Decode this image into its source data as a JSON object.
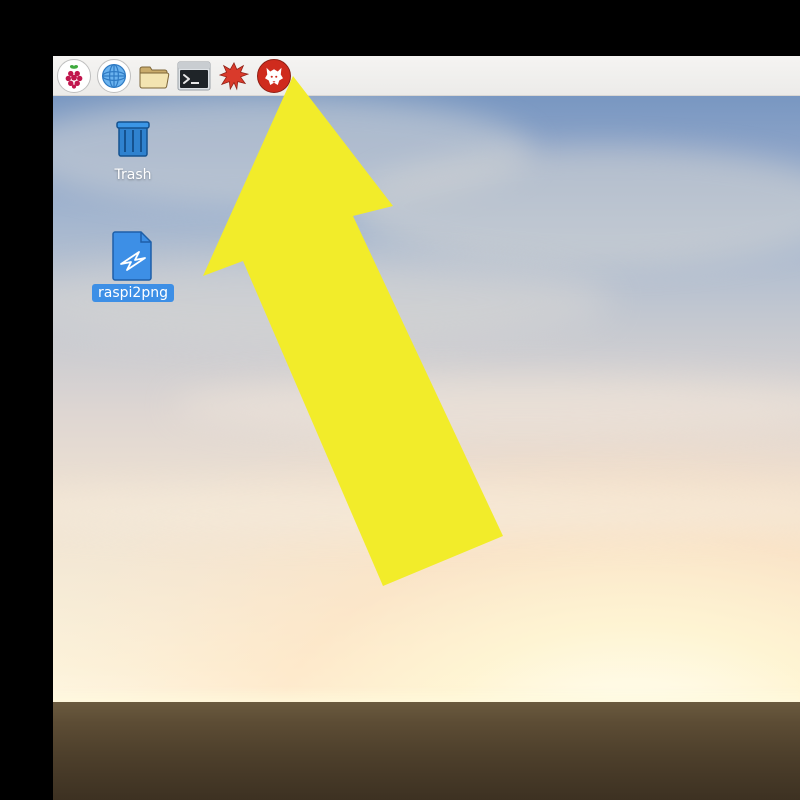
{
  "panel": {
    "items": [
      {
        "name": "app-menu-button",
        "icon": "raspberry-icon",
        "tooltip": "Menu"
      },
      {
        "name": "web-browser-launcher",
        "icon": "globe-icon",
        "tooltip": "Web Browser"
      },
      {
        "name": "file-manager-launcher",
        "icon": "folder-icon",
        "tooltip": "File Manager"
      },
      {
        "name": "terminal-launcher",
        "icon": "terminal-icon",
        "tooltip": "Terminal"
      },
      {
        "name": "mathematica-launcher",
        "icon": "spiky-icon",
        "tooltip": "Mathematica"
      },
      {
        "name": "wolfram-launcher",
        "icon": "wolf-icon",
        "tooltip": "Wolfram"
      }
    ]
  },
  "desktop": {
    "icons": [
      {
        "name": "trash-desktop-icon",
        "label": "Trash",
        "selected": false
      },
      {
        "name": "raspi2png-desktop-icon",
        "label": "raspi2png",
        "selected": true
      }
    ]
  },
  "annotation": {
    "kind": "arrow",
    "color": "#f2ec2a",
    "points_to": "terminal-launcher"
  }
}
